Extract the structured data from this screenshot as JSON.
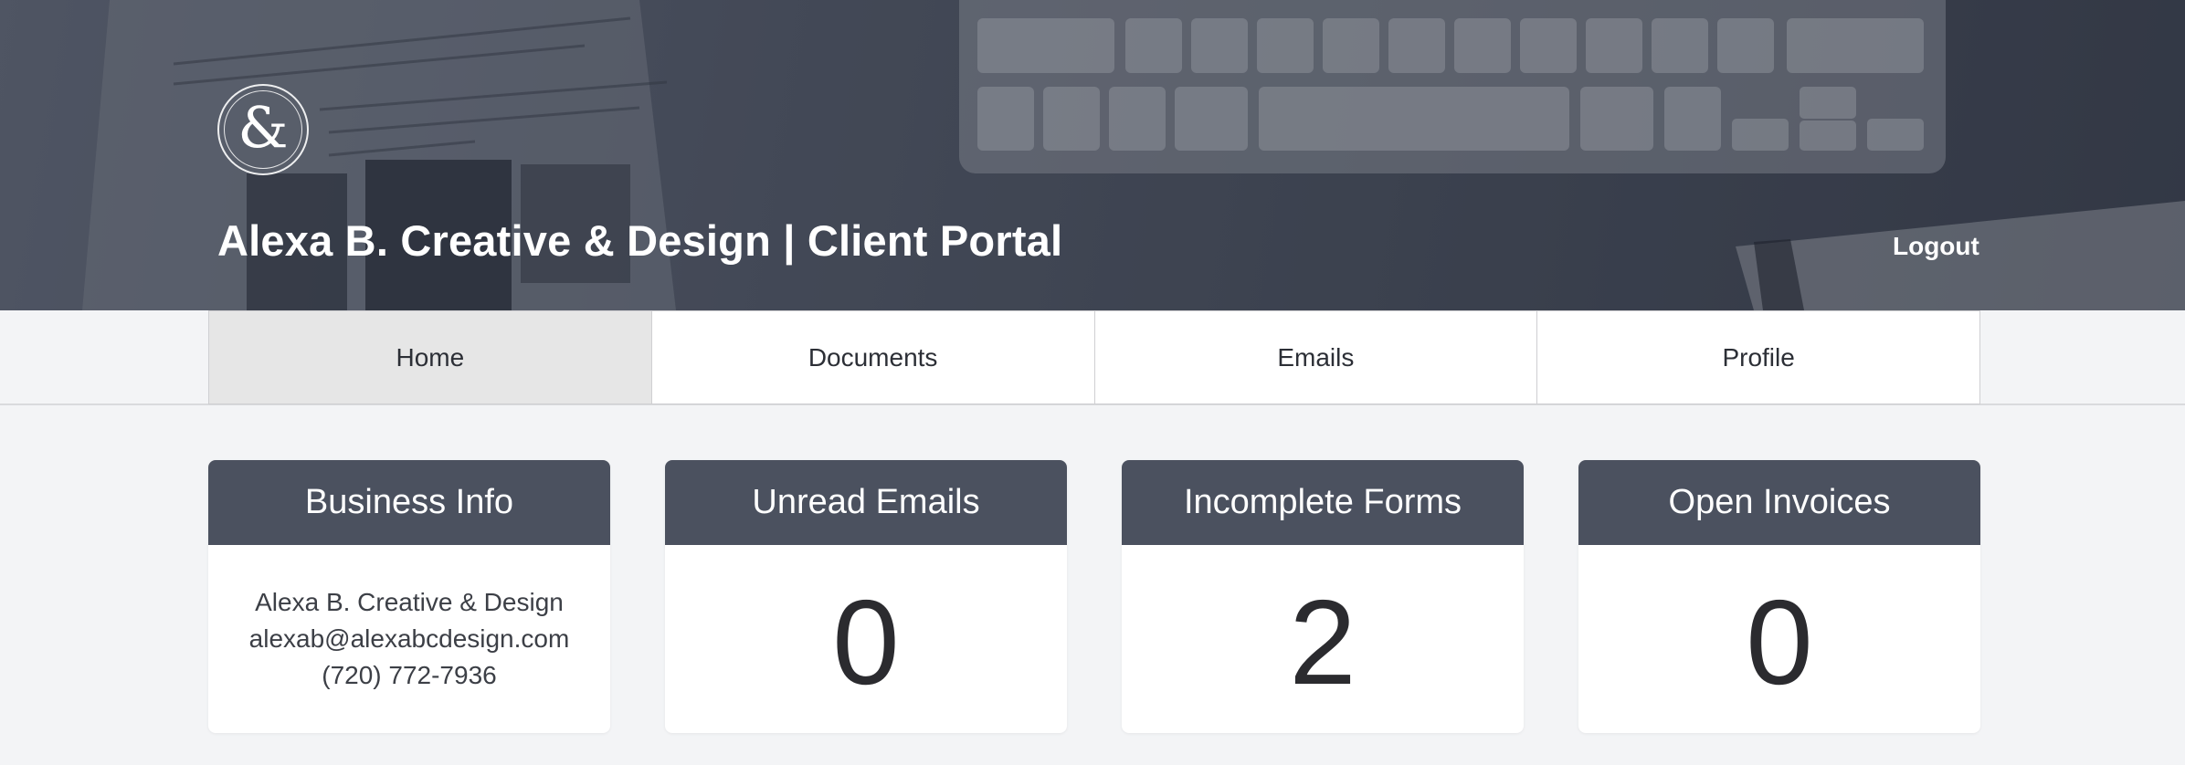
{
  "header": {
    "logo_glyph": "&",
    "title": "Alexa B. Creative & Design | Client Portal",
    "logout_label": "Logout"
  },
  "nav": {
    "tabs": [
      {
        "label": "Home",
        "active": true
      },
      {
        "label": "Documents",
        "active": false
      },
      {
        "label": "Emails",
        "active": false
      },
      {
        "label": "Profile",
        "active": false
      }
    ]
  },
  "cards": {
    "business_info": {
      "title": "Business Info",
      "name": "Alexa B. Creative & Design",
      "email": "alexab@alexabcdesign.com",
      "phone": "(720) 772-7936"
    },
    "unread_emails": {
      "title": "Unread Emails",
      "count": "0"
    },
    "incomplete_forms": {
      "title": "Incomplete Forms",
      "count": "2"
    },
    "open_invoices": {
      "title": "Open Invoices",
      "count": "0"
    }
  },
  "colors": {
    "card_header": "#4b515f",
    "active_tab": "#e6e6e6",
    "page_bg": "#f3f4f6"
  }
}
